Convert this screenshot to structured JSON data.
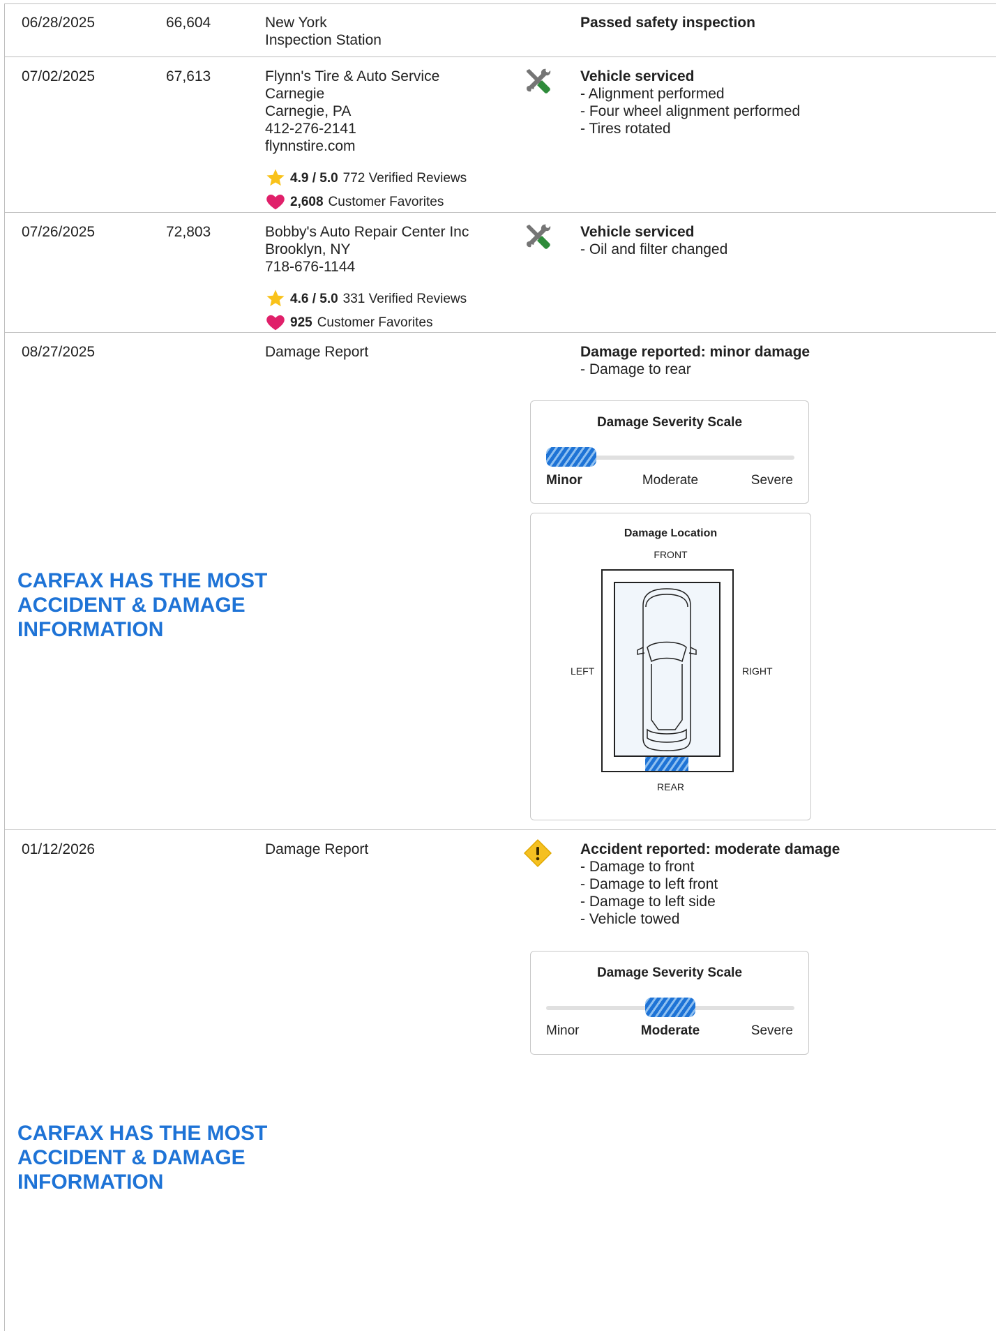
{
  "rows": [
    {
      "date": "06/28/2025",
      "odometer": "66,604",
      "source": [
        "New York",
        "Inspection Station"
      ],
      "detail_title": "Passed safety inspection",
      "detail_lines": []
    },
    {
      "date": "07/02/2025",
      "odometer": "67,613",
      "source": [
        "Flynn's Tire & Auto Service",
        "Carnegie",
        "Carnegie, PA",
        "412-276-2141",
        "flynnstire.com"
      ],
      "rating": "4.9 / 5.0",
      "reviews": "772 Verified Reviews",
      "favorites": "2,608",
      "favorites_label": "Customer Favorites",
      "icon": "wrench-screwdriver-icon",
      "detail_title": "Vehicle serviced",
      "detail_lines": [
        "- Alignment performed",
        "- Four wheel alignment performed",
        "- Tires rotated"
      ]
    },
    {
      "date": "07/26/2025",
      "odometer": "72,803",
      "source": [
        "Bobby's Auto Repair Center Inc",
        "Brooklyn, NY",
        "718-676-1144"
      ],
      "rating": "4.6 / 5.0",
      "reviews": "331 Verified Reviews",
      "favorites": "925",
      "favorites_label": "Customer Favorites",
      "icon": "wrench-screwdriver-icon",
      "detail_title": "Vehicle serviced",
      "detail_lines": [
        "- Oil and filter changed"
      ]
    },
    {
      "date": "08/27/2025",
      "source": [
        "Damage Report"
      ],
      "detail_title": "Damage reported: minor damage",
      "detail_lines": [
        "- Damage to rear"
      ],
      "promo": "CARFAX HAS THE MOST ACCIDENT & DAMAGE INFORMATION",
      "severity": {
        "title": "Damage Severity Scale",
        "labels": [
          "Minor",
          "Moderate",
          "Severe"
        ],
        "level": "Minor"
      },
      "location": {
        "title": "Damage Location",
        "front": "FRONT",
        "rear": "REAR",
        "left": "LEFT",
        "right": "RIGHT",
        "damaged_area": "rear"
      }
    },
    {
      "date": "01/12/2026",
      "source": [
        "Damage Report"
      ],
      "icon": "warning-icon",
      "detail_title": "Accident reported: moderate damage",
      "detail_lines": [
        "- Damage to front",
        "- Damage to left front",
        "- Damage to left side",
        "- Vehicle towed"
      ],
      "promo": "CARFAX HAS THE MOST ACCIDENT & DAMAGE INFORMATION",
      "severity": {
        "title": "Damage Severity Scale",
        "labels": [
          "Minor",
          "Moderate",
          "Severe"
        ],
        "level": "Moderate"
      }
    }
  ],
  "colors": {
    "accent": "#1e73d6",
    "star": "#f9c21a",
    "heart": "#e0206a",
    "warning": "#f5c021",
    "tool_green": "#2e8b3a"
  }
}
